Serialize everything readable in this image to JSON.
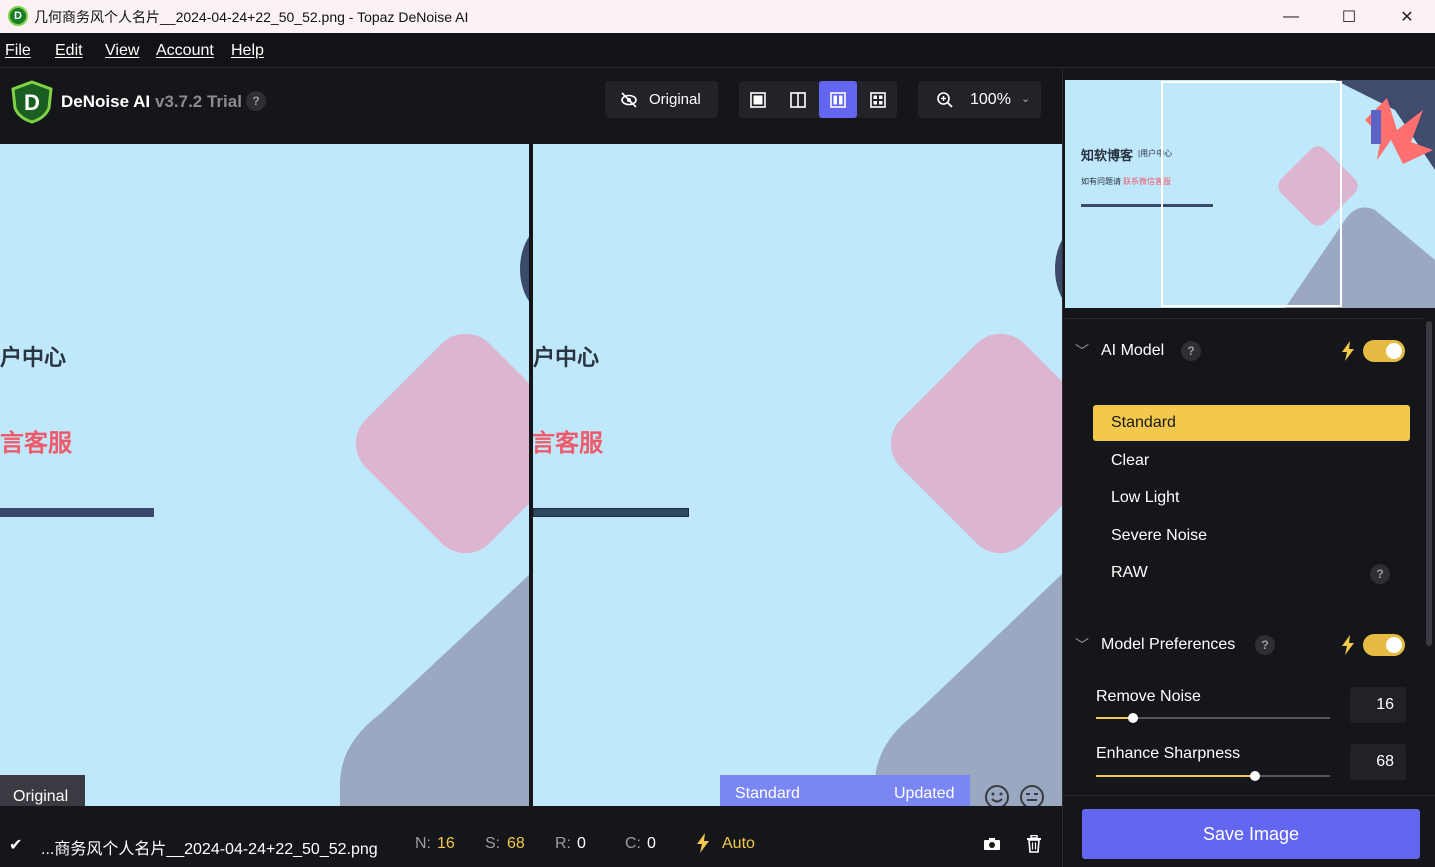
{
  "window": {
    "title": "几何商务风个人名片__2024-04-24+22_50_52.png - Topaz DeNoise AI",
    "minimize": "—",
    "maximize": "☐",
    "close": "✕"
  },
  "menu": [
    "File",
    "Edit",
    "View",
    "Account",
    "Help"
  ],
  "app": {
    "logo_letter": "D",
    "name": "DeNoise AI",
    "version": "v3.7.2 Trial",
    "help": "?"
  },
  "toolbar": {
    "original_label": "Original",
    "zoom": "100%"
  },
  "canvas": {
    "left_text1": "户中心",
    "left_text2": "言客服",
    "right_text1": "户中心",
    "right_text2": "言客服",
    "original_tag": "Original",
    "model_tag": "Standard",
    "updated_tag": "Updated"
  },
  "preview": {
    "line1_bold": "知软博客",
    "line1_small": "|用户中心",
    "line2_prefix": "如有问题请",
    "line2_red": "联系微信客服"
  },
  "ai_model": {
    "title": "AI Model",
    "help": "?",
    "options": [
      "Standard",
      "Clear",
      "Low Light",
      "Severe Noise",
      "RAW"
    ],
    "selected": "Standard",
    "raw_help": "?"
  },
  "model_preferences": {
    "title": "Model Preferences",
    "help": "?",
    "remove_noise_label": "Remove Noise",
    "remove_noise_value": "16",
    "remove_noise_fraction": 0.16,
    "enhance_sharpness_label": "Enhance Sharpness",
    "enhance_sharpness_value": "68",
    "enhance_sharpness_fraction": 0.68
  },
  "save_button": "Save Image",
  "status": {
    "check": "✔",
    "filename": "...商务风个人名片__2024-04-24+22_50_52.png",
    "n_label": "N:",
    "n_value": "16",
    "s_label": "S:",
    "s_value": "68",
    "r_label": "R:",
    "r_value": "0",
    "c_label": "C:",
    "c_value": "0",
    "mode": "Auto"
  },
  "colors": {
    "accent": "#6366f1",
    "highlight": "#f2c94c",
    "canvas_bg": "#bfe9fa",
    "pink": "#dcb6d0",
    "slate": "#9aa8c2"
  }
}
